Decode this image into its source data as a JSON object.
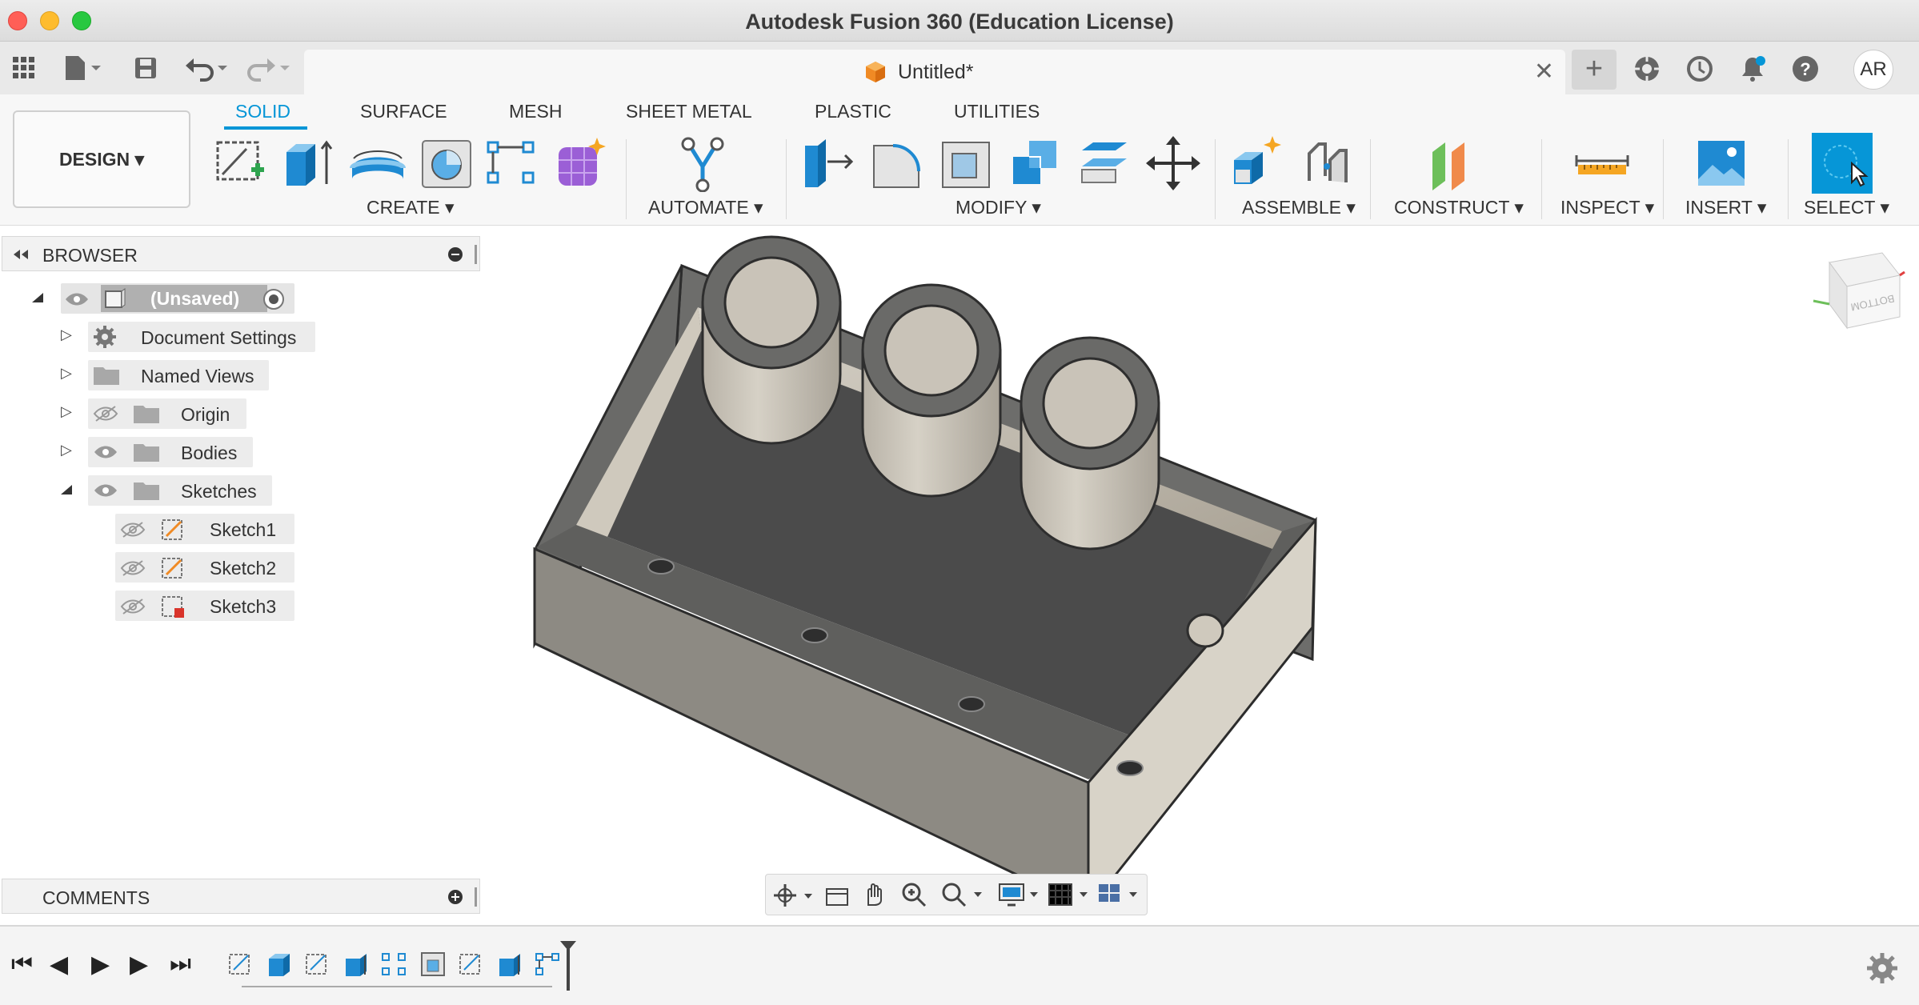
{
  "window": {
    "title": "Autodesk Fusion 360 (Education License)"
  },
  "document_tab": {
    "title": "Untitled*",
    "close_glyph": "✕"
  },
  "new_tab_glyph": "+",
  "user": {
    "initials": "AR"
  },
  "workspace": {
    "label": "DESIGN ▾"
  },
  "tabs": [
    {
      "label": "SOLID",
      "active": true
    },
    {
      "label": "SURFACE"
    },
    {
      "label": "MESH"
    },
    {
      "label": "SHEET METAL"
    },
    {
      "label": "PLASTIC"
    },
    {
      "label": "UTILITIES"
    }
  ],
  "toolbar_groups": {
    "create": "CREATE ▾",
    "automate": "AUTOMATE ▾",
    "modify": "MODIFY ▾",
    "assemble": "ASSEMBLE ▾",
    "construct": "CONSTRUCT ▾",
    "inspect": "INSPECT ▾",
    "insert": "INSERT ▾",
    "select": "SELECT ▾"
  },
  "browser": {
    "title": "BROWSER",
    "root": "(Unsaved)",
    "items": [
      {
        "label": "Document Settings"
      },
      {
        "label": "Named Views"
      },
      {
        "label": "Origin"
      },
      {
        "label": "Bodies"
      },
      {
        "label": "Sketches"
      }
    ],
    "sketches": [
      {
        "label": "Sketch1"
      },
      {
        "label": "Sketch2"
      },
      {
        "label": "Sketch3"
      }
    ]
  },
  "comments": {
    "title": "COMMENTS"
  },
  "viewcube": {
    "face_label": "BOTTOM"
  },
  "colors": {
    "accent": "#0696d7",
    "body": "#c9c3b8"
  }
}
